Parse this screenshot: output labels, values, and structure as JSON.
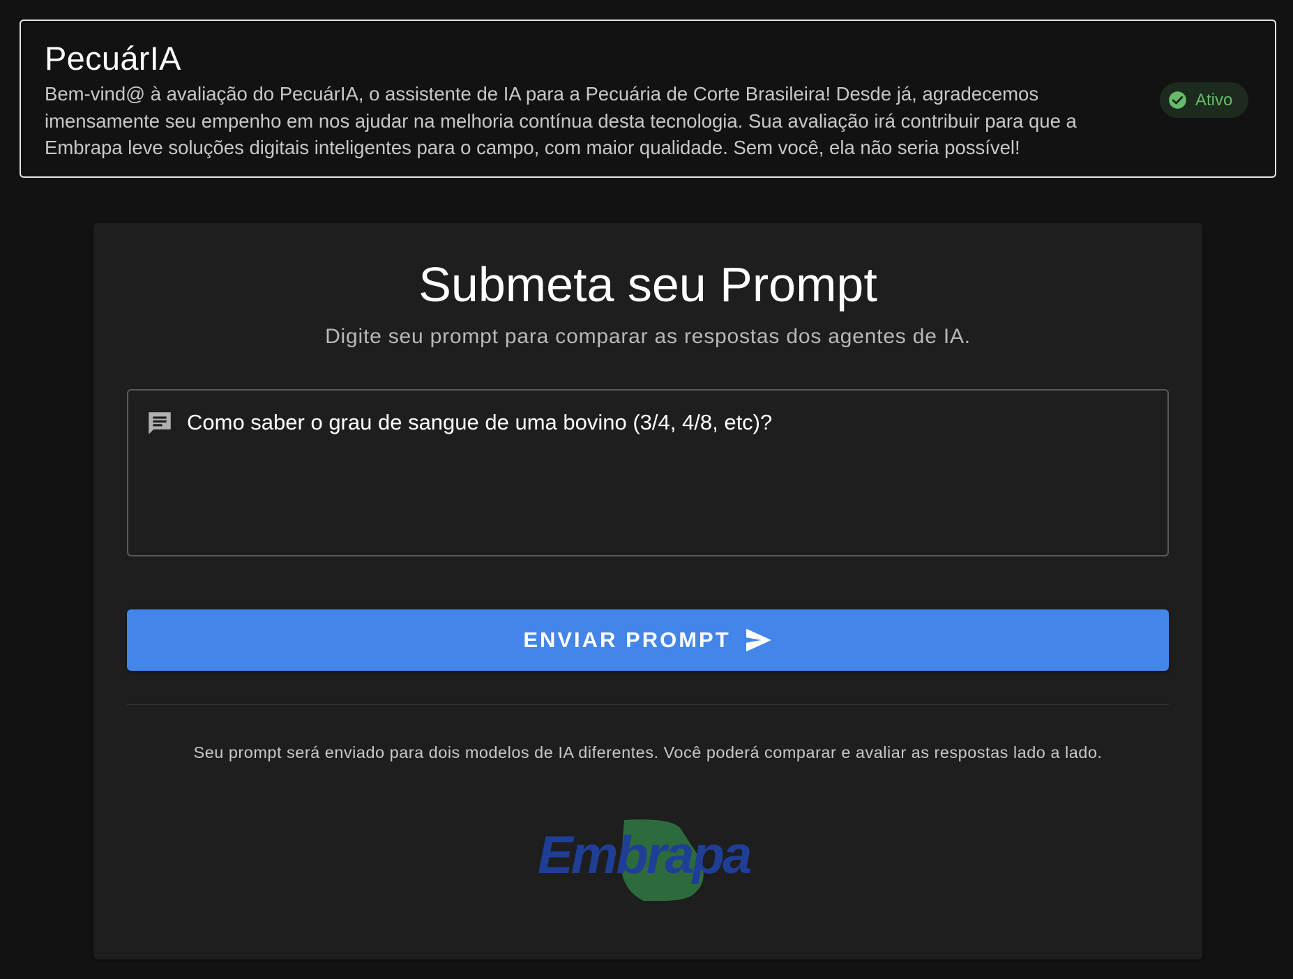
{
  "header": {
    "title": "PecuárIA",
    "welcome": "Bem-vind@ à avaliação do PecuárIA, o assistente de IA para a Pecuária de Corte Brasileira! Desde já, agradecemos imensamente seu empenho em nos ajudar na melhoria contínua desta tecnologia. Sua avaliação irá contribuir para que a Embrapa leve soluções digitais inteligentes para o campo, com maior qualidade. Sem você, ela não seria possível!",
    "status": {
      "label": "Ativo",
      "icon": "check-circle-icon",
      "color": "#66bb6a"
    }
  },
  "main": {
    "title": "Submeta seu Prompt",
    "subtitle": "Digite seu prompt para comparar as respostas dos agentes de IA.",
    "prompt": {
      "icon": "chat-icon",
      "value": "Como saber o grau de sangue de uma bovino (3/4, 4/8, etc)?"
    },
    "send_button": {
      "label": "ENVIAR PROMPT",
      "icon": "send-icon",
      "color": "#4385e8"
    },
    "info": "Seu prompt será enviado para dois modelos de IA diferentes. Você poderá comparar e avaliar as respostas lado a lado.",
    "logo": {
      "text": "Embrapa",
      "colors": {
        "blue": "#1f3f96",
        "green": "#2e6b3c"
      }
    }
  },
  "theme": {
    "background": "#121212",
    "card": "#1e1e1e",
    "accent": "#4385e8"
  }
}
